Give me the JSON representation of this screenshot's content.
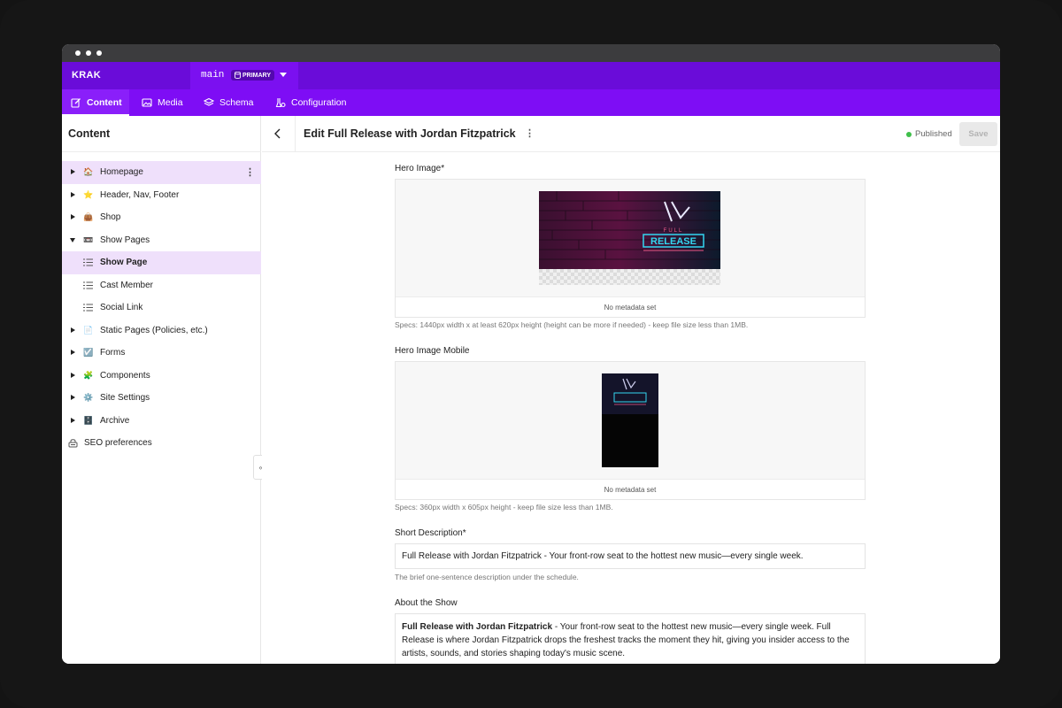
{
  "app": {
    "brand": "KRAK"
  },
  "environment": {
    "name": "main",
    "badge": "PRIMARY"
  },
  "nav": {
    "tabs": [
      {
        "label": "Content",
        "icon": "edit-icon",
        "active": true
      },
      {
        "label": "Media",
        "icon": "image-icon",
        "active": false
      },
      {
        "label": "Schema",
        "icon": "layers-icon",
        "active": false
      },
      {
        "label": "Configuration",
        "icon": "config-icon",
        "active": false
      }
    ]
  },
  "sidebar": {
    "title": "Content",
    "items": [
      {
        "label": "Homepage",
        "emoji": "🏠",
        "expandable": true,
        "selected": true
      },
      {
        "label": "Header, Nav, Footer",
        "emoji": "⭐",
        "expandable": true
      },
      {
        "label": "Shop",
        "emoji": "👜",
        "expandable": true
      },
      {
        "label": "Show Pages",
        "emoji": "📼",
        "expandable": true,
        "open": true
      },
      {
        "label": "Show Page",
        "child": true,
        "selected": true,
        "bold": true
      },
      {
        "label": "Cast Member",
        "child": true
      },
      {
        "label": "Social Link",
        "child": true
      },
      {
        "label": "Static Pages (Policies, etc.)",
        "emoji": "📄",
        "expandable": true
      },
      {
        "label": "Forms",
        "emoji": "☑️",
        "expandable": true
      },
      {
        "label": "Components",
        "emoji": "🧩",
        "expandable": true
      },
      {
        "label": "Site Settings",
        "emoji": "⚙️",
        "expandable": true
      },
      {
        "label": "Archive",
        "emoji": "🗄️",
        "expandable": true
      }
    ],
    "seo_label": "SEO preferences",
    "collapse_glyph": "«"
  },
  "header": {
    "title": "Edit Full Release with Jordan Fitzpatrick",
    "status": "Published",
    "save_label": "Save",
    "status_color": "#3fbf4a"
  },
  "form": {
    "hero_image": {
      "label": "Hero Image*",
      "meta": "No metadata set",
      "spec": "Specs: 1440px width x at least 620px height (height can be more if needed) - keep file size less than 1MB.",
      "art_title_top": "FULL",
      "art_title": "RELEASE"
    },
    "hero_image_mobile": {
      "label": "Hero Image Mobile",
      "meta": "No metadata set",
      "spec": "Specs: 360px width x 605px height - keep file size less than 1MB."
    },
    "short_description": {
      "label": "Short Description*",
      "value": "Full Release with Jordan Fitzpatrick - Your front-row seat to the hottest new music—every single week.",
      "hint": "The brief one-sentence description under the schedule."
    },
    "about": {
      "label": "About the Show",
      "bold_lead": "Full Release with Jordan Fitzpatrick",
      "text": " - Your front-row seat to the hottest new music—every single week. Full Release is where Jordan Fitzpatrick drops the freshest tracks the moment they hit, giving you insider access to the artists, sounds, and stories shaping today's music scene."
    }
  },
  "colors": {
    "topbar": "#6a0cd9",
    "navbar": "#7e0df5",
    "accent": "#8a1ffa",
    "selection": "#efe0fb"
  }
}
